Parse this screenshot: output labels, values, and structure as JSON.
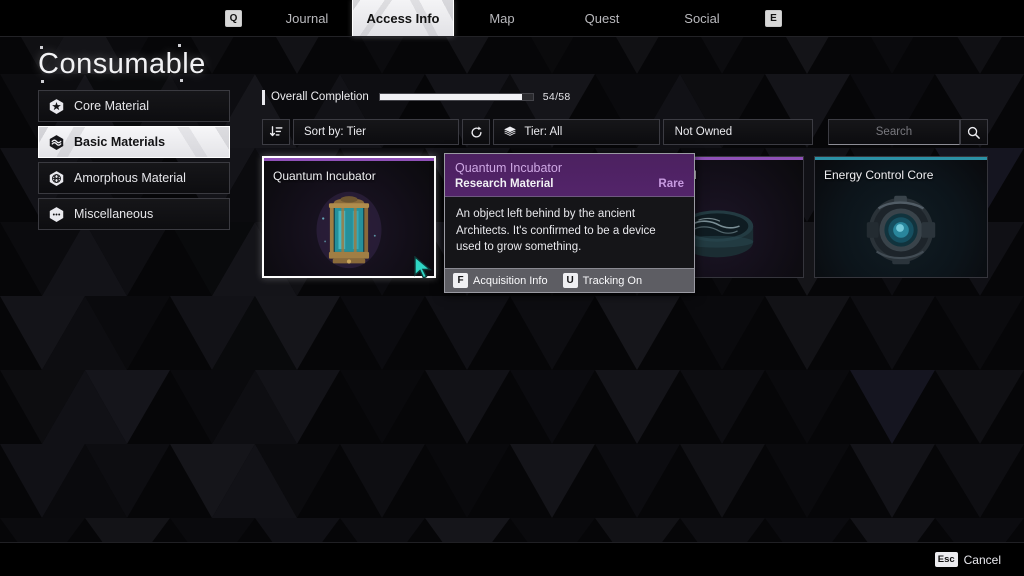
{
  "topnav": {
    "left_key": "Q",
    "right_key": "E",
    "tabs": [
      {
        "label": "Journal",
        "active": false
      },
      {
        "label": "Access Info",
        "active": true
      },
      {
        "label": "Map",
        "active": false
      },
      {
        "label": "Quest",
        "active": false
      },
      {
        "label": "Social",
        "active": false
      }
    ]
  },
  "page": {
    "title": "Consumable"
  },
  "sidebar": {
    "items": [
      {
        "label": "Core Material",
        "icon": "hex-star-icon",
        "active": false
      },
      {
        "label": "Basic Materials",
        "icon": "hex-wave-icon",
        "active": true
      },
      {
        "label": "Amorphous Material",
        "icon": "hex-globe-icon",
        "active": false
      },
      {
        "label": "Miscellaneous",
        "icon": "hex-dots-icon",
        "active": false
      }
    ]
  },
  "completion": {
    "label": "Overall Completion",
    "count": "54/58",
    "percent": 93,
    "current": 54,
    "total": 58
  },
  "toolbar": {
    "sort_icon": "sort-descending-icon",
    "sort_label": "Sort by: Tier",
    "refresh_icon": "refresh-icon",
    "tier_icon": "layers-icon",
    "tier_label": "Tier: All",
    "owned_label": "Not Owned",
    "search_placeholder": "Search",
    "search_value": "",
    "search_icon": "search-icon"
  },
  "cards": [
    {
      "name": "Quantum Incubator",
      "accent": "purple",
      "selected": true,
      "art": "incubator"
    },
    {
      "name": "",
      "accent": "purple",
      "selected": false,
      "art": "none"
    },
    {
      "name": "d Biometal",
      "accent": "purple",
      "selected": false,
      "art": "biometal"
    },
    {
      "name": "Energy Control Core",
      "accent": "teal",
      "selected": false,
      "art": "core"
    }
  ],
  "tooltip": {
    "title": "Quantum Incubator",
    "type": "Research Material",
    "rarity": "Rare",
    "description": "An object left behind by the ancient Architects. It's confirmed to be a device used to grow something.",
    "actions": [
      {
        "key": "F",
        "label": "Acquisition Info"
      },
      {
        "key": "U",
        "label": "Tracking On"
      }
    ]
  },
  "bottombar": {
    "key": "Esc",
    "label": "Cancel"
  },
  "colors": {
    "accent_purple": "#8f51b8",
    "accent_teal": "#2b91a6",
    "rarity_rare": "#c79ae0",
    "tooltip_header": "#53246a",
    "progress_fill": "#f1f1f4"
  }
}
